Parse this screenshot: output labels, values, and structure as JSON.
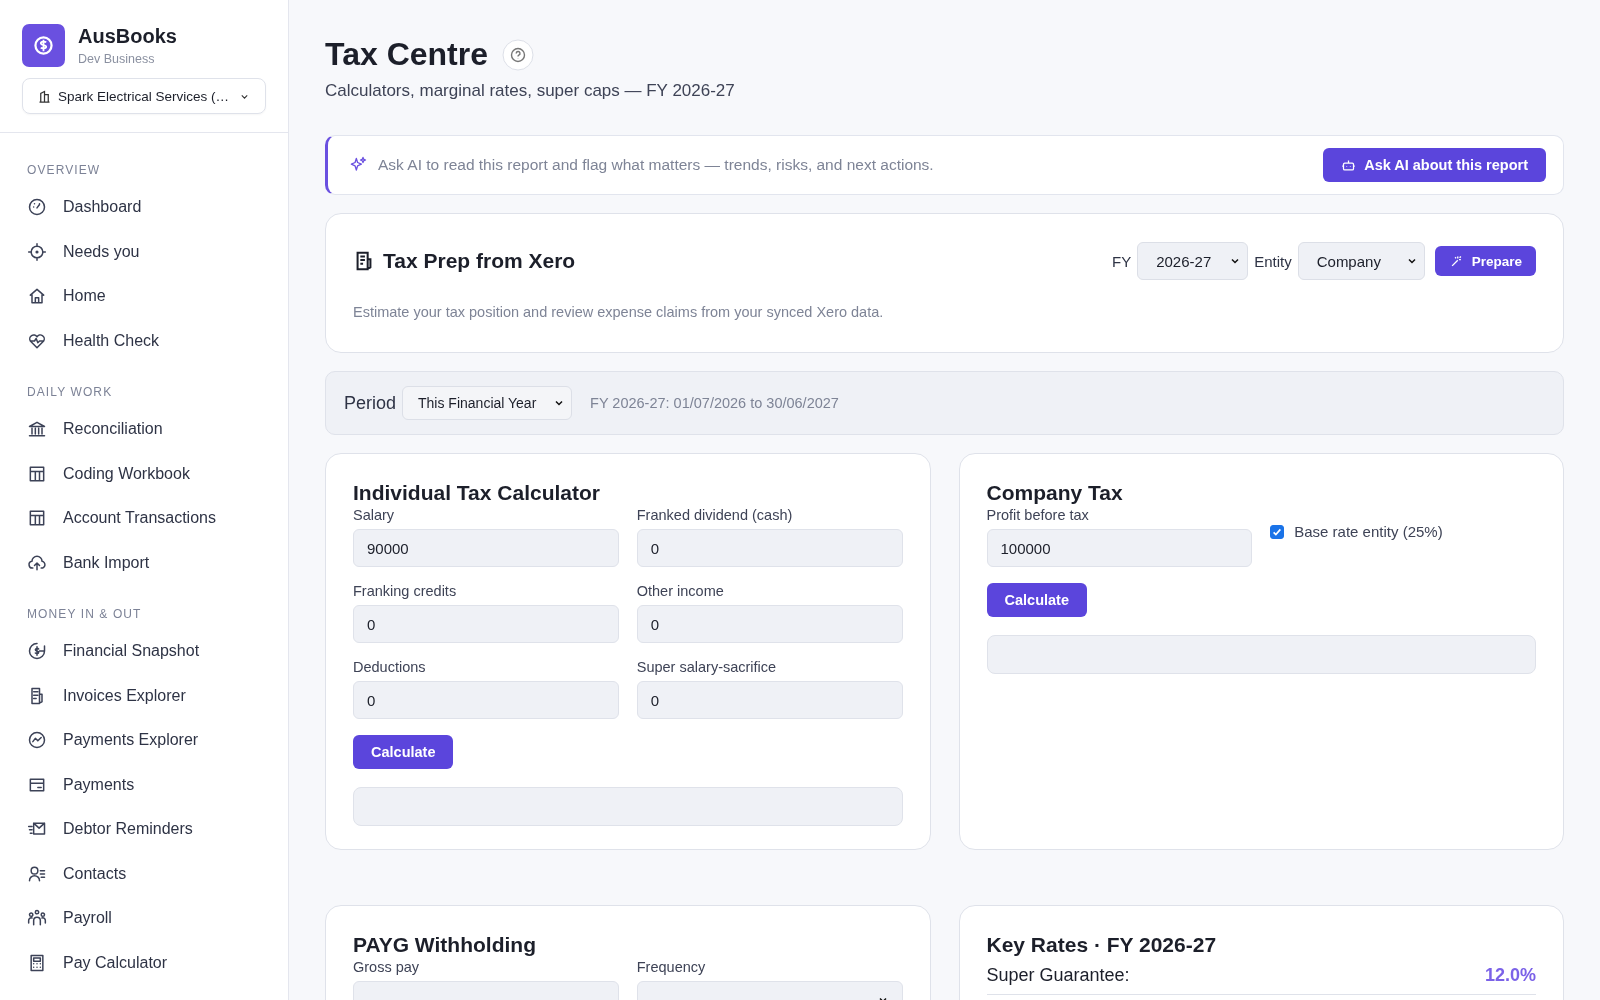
{
  "brand": {
    "name": "AusBooks",
    "subtitle": "Dev Business"
  },
  "org_selector": {
    "value": "Spark Electrical Services (…"
  },
  "nav": [
    {
      "heading": "OVERVIEW",
      "items": [
        {
          "label": "Dashboard"
        },
        {
          "label": "Needs you"
        },
        {
          "label": "Home"
        },
        {
          "label": "Health Check"
        }
      ]
    },
    {
      "heading": "DAILY WORK",
      "items": [
        {
          "label": "Reconciliation"
        },
        {
          "label": "Coding Workbook"
        },
        {
          "label": "Account Transactions"
        },
        {
          "label": "Bank Import"
        }
      ]
    },
    {
      "heading": "MONEY IN & OUT",
      "items": [
        {
          "label": "Financial Snapshot"
        },
        {
          "label": "Invoices Explorer"
        },
        {
          "label": "Payments Explorer"
        },
        {
          "label": "Payments"
        },
        {
          "label": "Debtor Reminders"
        },
        {
          "label": "Contacts"
        },
        {
          "label": "Payroll"
        },
        {
          "label": "Pay Calculator"
        }
      ]
    }
  ],
  "page": {
    "title": "Tax Centre",
    "subtitle": "Calculators, marginal rates, super caps — FY 2026-27"
  },
  "ai_banner": {
    "text": "Ask AI to read this report and flag what matters — trends, risks, and next actions.",
    "button": "Ask AI about this report"
  },
  "tax_prep": {
    "title": "Tax Prep from Xero",
    "fy_label": "FY",
    "fy_value": "2026-27",
    "entity_label": "Entity",
    "entity_value": "Company",
    "button": "Prepare",
    "description": "Estimate your tax position and review expense claims from your synced Xero data."
  },
  "period": {
    "label": "Period",
    "value": "This Financial Year",
    "range": "FY 2026-27: 01/07/2026 to 30/06/2027"
  },
  "individual": {
    "title": "Individual Tax Calculator",
    "fields": [
      {
        "label": "Salary",
        "value": "90000"
      },
      {
        "label": "Franked dividend (cash)",
        "value": "0"
      },
      {
        "label": "Franking credits",
        "value": "0"
      },
      {
        "label": "Other income",
        "value": "0"
      },
      {
        "label": "Deductions",
        "value": "0"
      },
      {
        "label": "Super salary-sacrifice",
        "value": "0"
      }
    ],
    "button": "Calculate"
  },
  "company": {
    "title": "Company Tax",
    "field": {
      "label": "Profit before tax",
      "value": "100000"
    },
    "checkbox": {
      "label": "Base rate entity (25%)",
      "checked": true
    },
    "button": "Calculate"
  },
  "payg": {
    "title": "PAYG Withholding",
    "fields": [
      {
        "label": "Gross pay",
        "kind": "input"
      },
      {
        "label": "Frequency",
        "kind": "select"
      }
    ]
  },
  "key_rates": {
    "title": "Key Rates · FY 2026-27",
    "rows": [
      {
        "label": "Super Guarantee:",
        "value": "12.0%"
      }
    ]
  }
}
